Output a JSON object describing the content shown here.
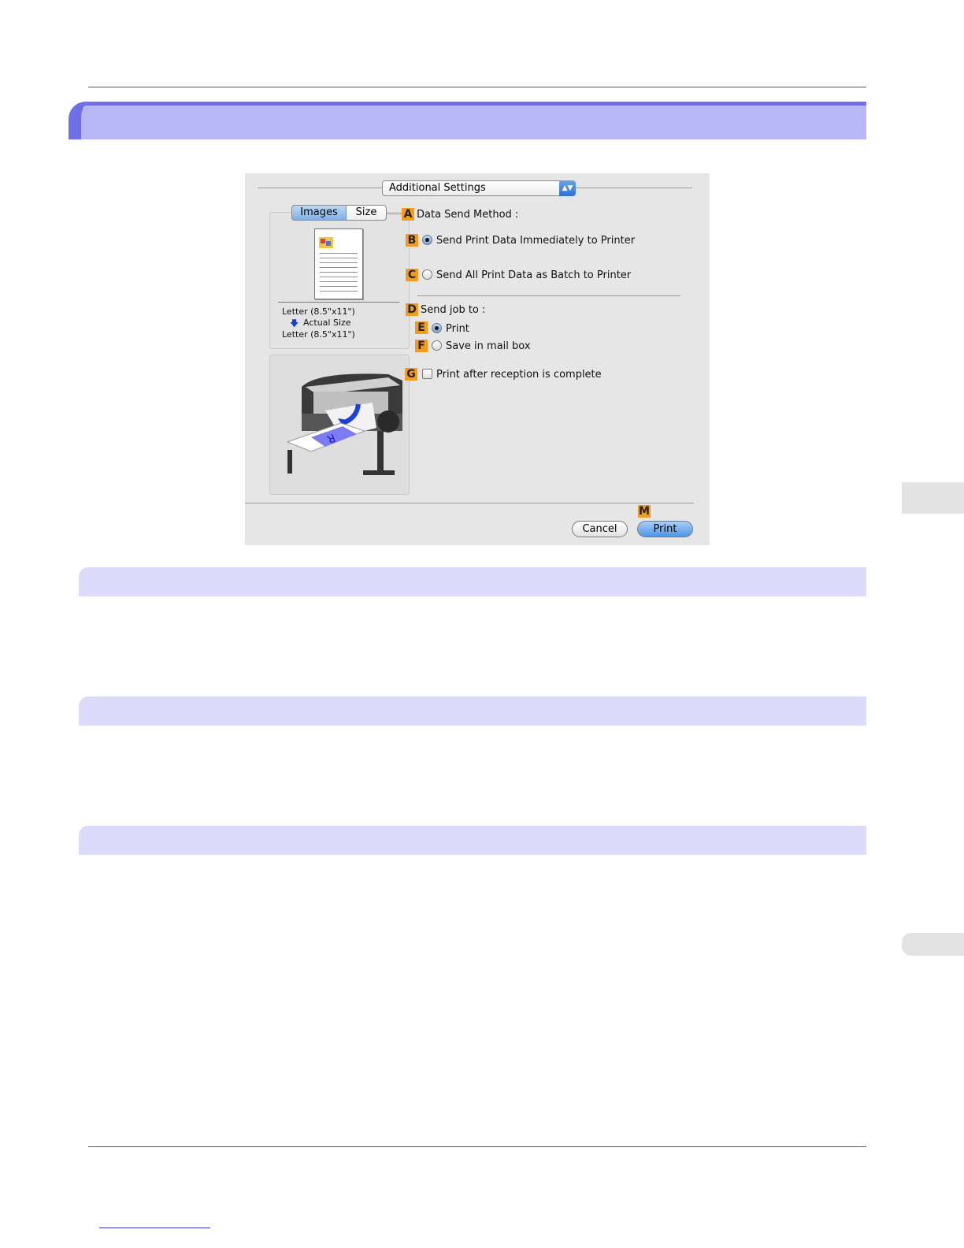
{
  "dialog": {
    "popup_label": "Additional Settings",
    "popup_arrows": "▲▼",
    "tabs": {
      "images": "Images",
      "size": "Size"
    },
    "preview": {
      "paper_from": "Letter (8.5\"x11\")",
      "scale_arrow": "🡇",
      "scale_label": "Actual Size",
      "paper_to": "Letter (8.5\"x11\")"
    },
    "options": {
      "a": {
        "badge": "A",
        "label": "Data Send Method :"
      },
      "b": {
        "badge": "B",
        "label": "Send Print Data Immediately to Printer",
        "selected": true
      },
      "c": {
        "badge": "C",
        "label": "Send All Print Data as Batch to Printer",
        "selected": false
      },
      "d": {
        "badge": "D",
        "label": "Send job to :"
      },
      "e": {
        "badge": "E",
        "label": "Print",
        "selected": true
      },
      "f": {
        "badge": "F",
        "label": "Save in mail box",
        "selected": false
      },
      "g": {
        "badge": "G",
        "label": "Print after reception is complete",
        "checked": false
      }
    },
    "buttons": {
      "m_badge": "M",
      "cancel": "Cancel",
      "print": "Print"
    }
  },
  "colors": {
    "title_band": "#b8b8f8",
    "title_band_edge": "#6f6fe8",
    "sub_band": "#dcdcfa",
    "badge": "#f39b1e"
  }
}
